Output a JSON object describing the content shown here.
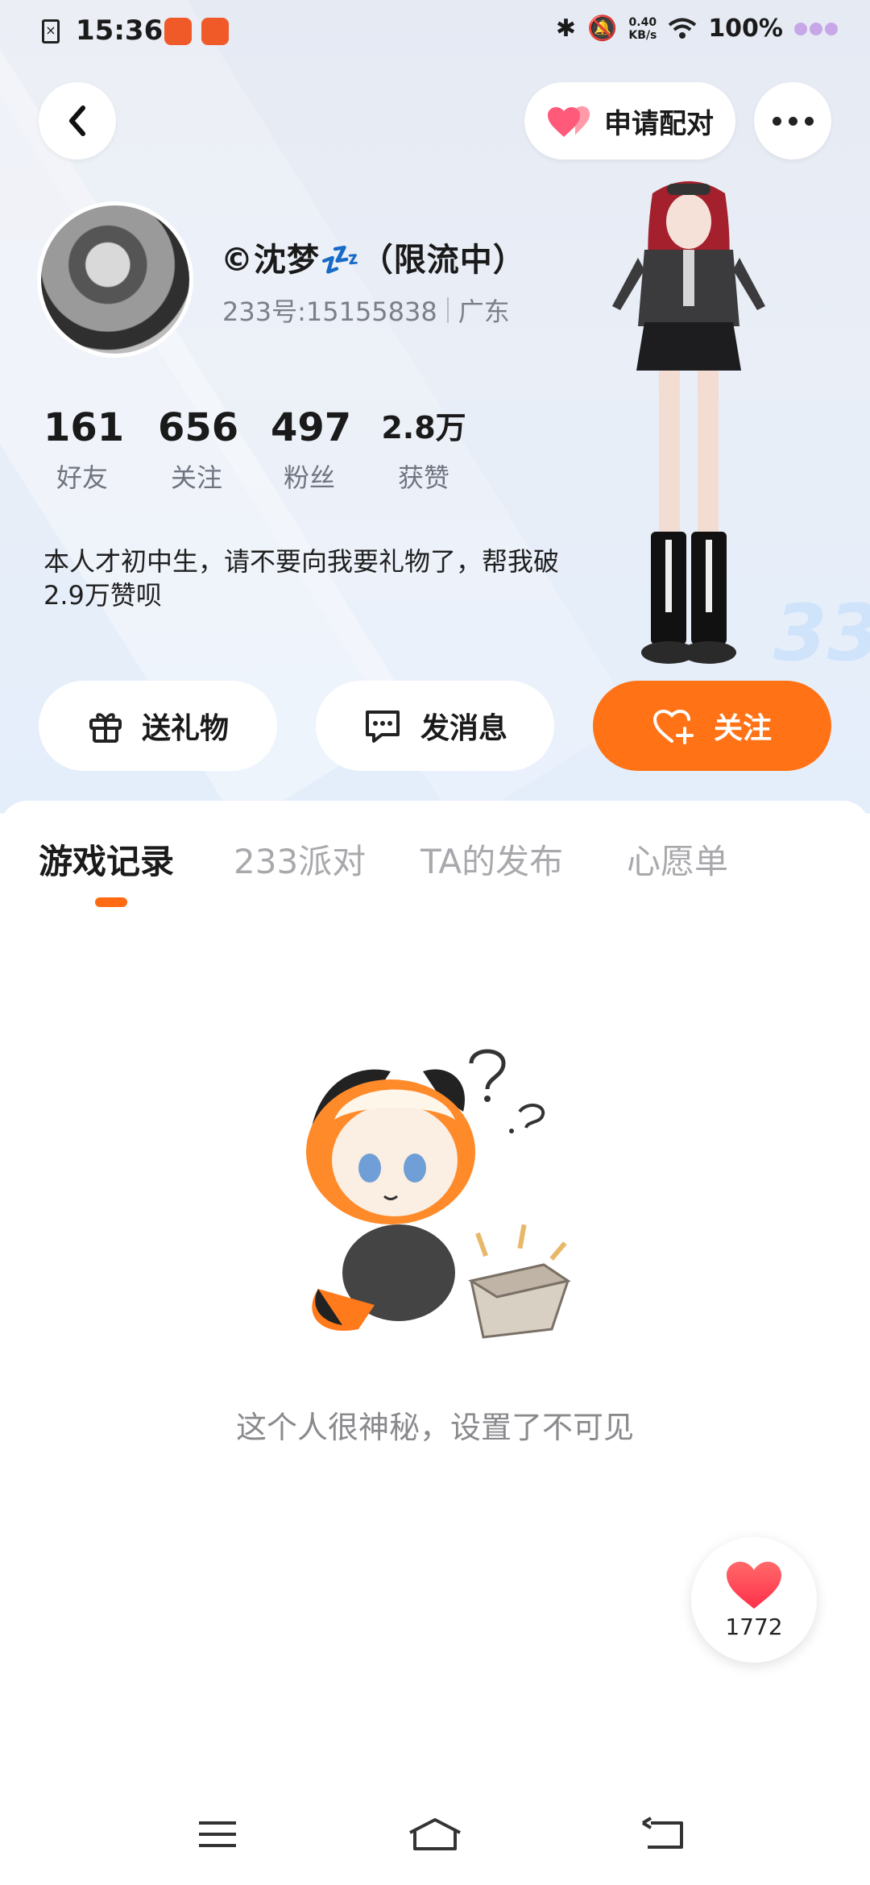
{
  "status_bar": {
    "time": "15:36",
    "net_speed_value": "0.40",
    "net_speed_unit": "KB/s",
    "battery": "100%"
  },
  "header": {
    "back_icon": "chevron-left-icon",
    "match_button_label": "申请配对",
    "more_icon": "more-dots-icon"
  },
  "profile": {
    "name": "©沈梦💤（限流中）",
    "id_text": "233号:15155838",
    "region": "广东",
    "stats": [
      {
        "value": "161",
        "label": "好友"
      },
      {
        "value": "656",
        "label": "关注"
      },
      {
        "value": "497",
        "label": "粉丝"
      },
      {
        "value": "2.8万",
        "label": "获赞"
      }
    ],
    "bio": "本人才初中生，请不要向我要礼物了，帮我破2.9万赞呗"
  },
  "actions": {
    "gift_label": "送礼物",
    "message_label": "发消息",
    "follow_label": "关注"
  },
  "tabs": [
    {
      "label": "游戏记录",
      "active": true
    },
    {
      "label": "233派对",
      "active": false
    },
    {
      "label": "TA的发布",
      "active": false
    },
    {
      "label": "心愿单",
      "active": false
    }
  ],
  "empty_state": {
    "message": "这个人很神秘，设置了不可见"
  },
  "like_float": {
    "count": "1772"
  },
  "colors": {
    "accent_orange": "#ff7316",
    "heart_pink": "#ff5a7a",
    "heart_red": "#ff3b4a"
  }
}
